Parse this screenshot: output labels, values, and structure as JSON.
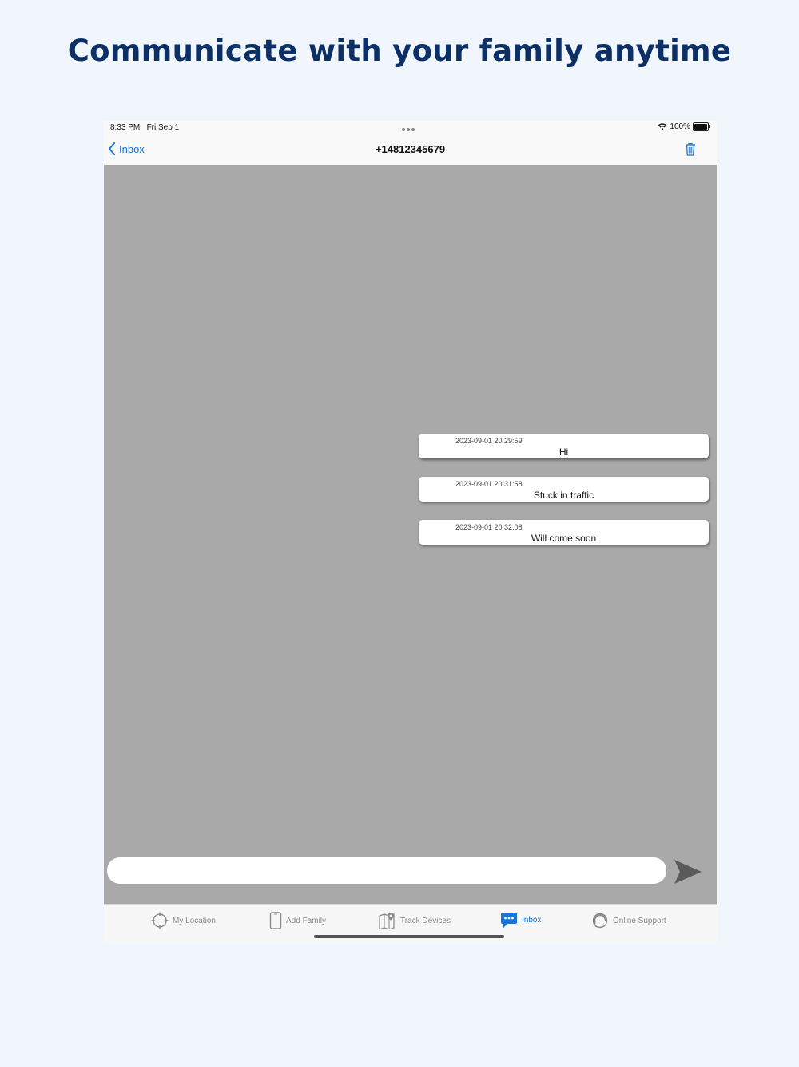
{
  "headline": "Communicate with your family anytime",
  "status_bar": {
    "time": "8:33 PM   Fri Sep 1",
    "battery": "100%"
  },
  "nav": {
    "back_label": "Inbox",
    "title": "+14812345679"
  },
  "messages": [
    {
      "timestamp": "2023-09-01 20:29:59",
      "text": "Hi"
    },
    {
      "timestamp": "2023-09-01 20:31:58",
      "text": "Stuck in traffic"
    },
    {
      "timestamp": "2023-09-01 20:32:08",
      "text": "Will come soon"
    }
  ],
  "composer": {
    "placeholder": "",
    "value": ""
  },
  "tabs": [
    {
      "label": "My Location",
      "icon": "crosshair-icon"
    },
    {
      "label": "Add Family",
      "icon": "phone-icon"
    },
    {
      "label": "Track Devices",
      "icon": "map-pin-icon"
    },
    {
      "label": "Inbox",
      "icon": "chat-bubble-icon",
      "active": true
    },
    {
      "label": "Online Support",
      "icon": "headset-icon"
    }
  ],
  "colors": {
    "accent": "#1a73d9",
    "headline": "#0c2f66",
    "chat_background": "#a9a9a9",
    "page_background": "#f1f6fd"
  }
}
